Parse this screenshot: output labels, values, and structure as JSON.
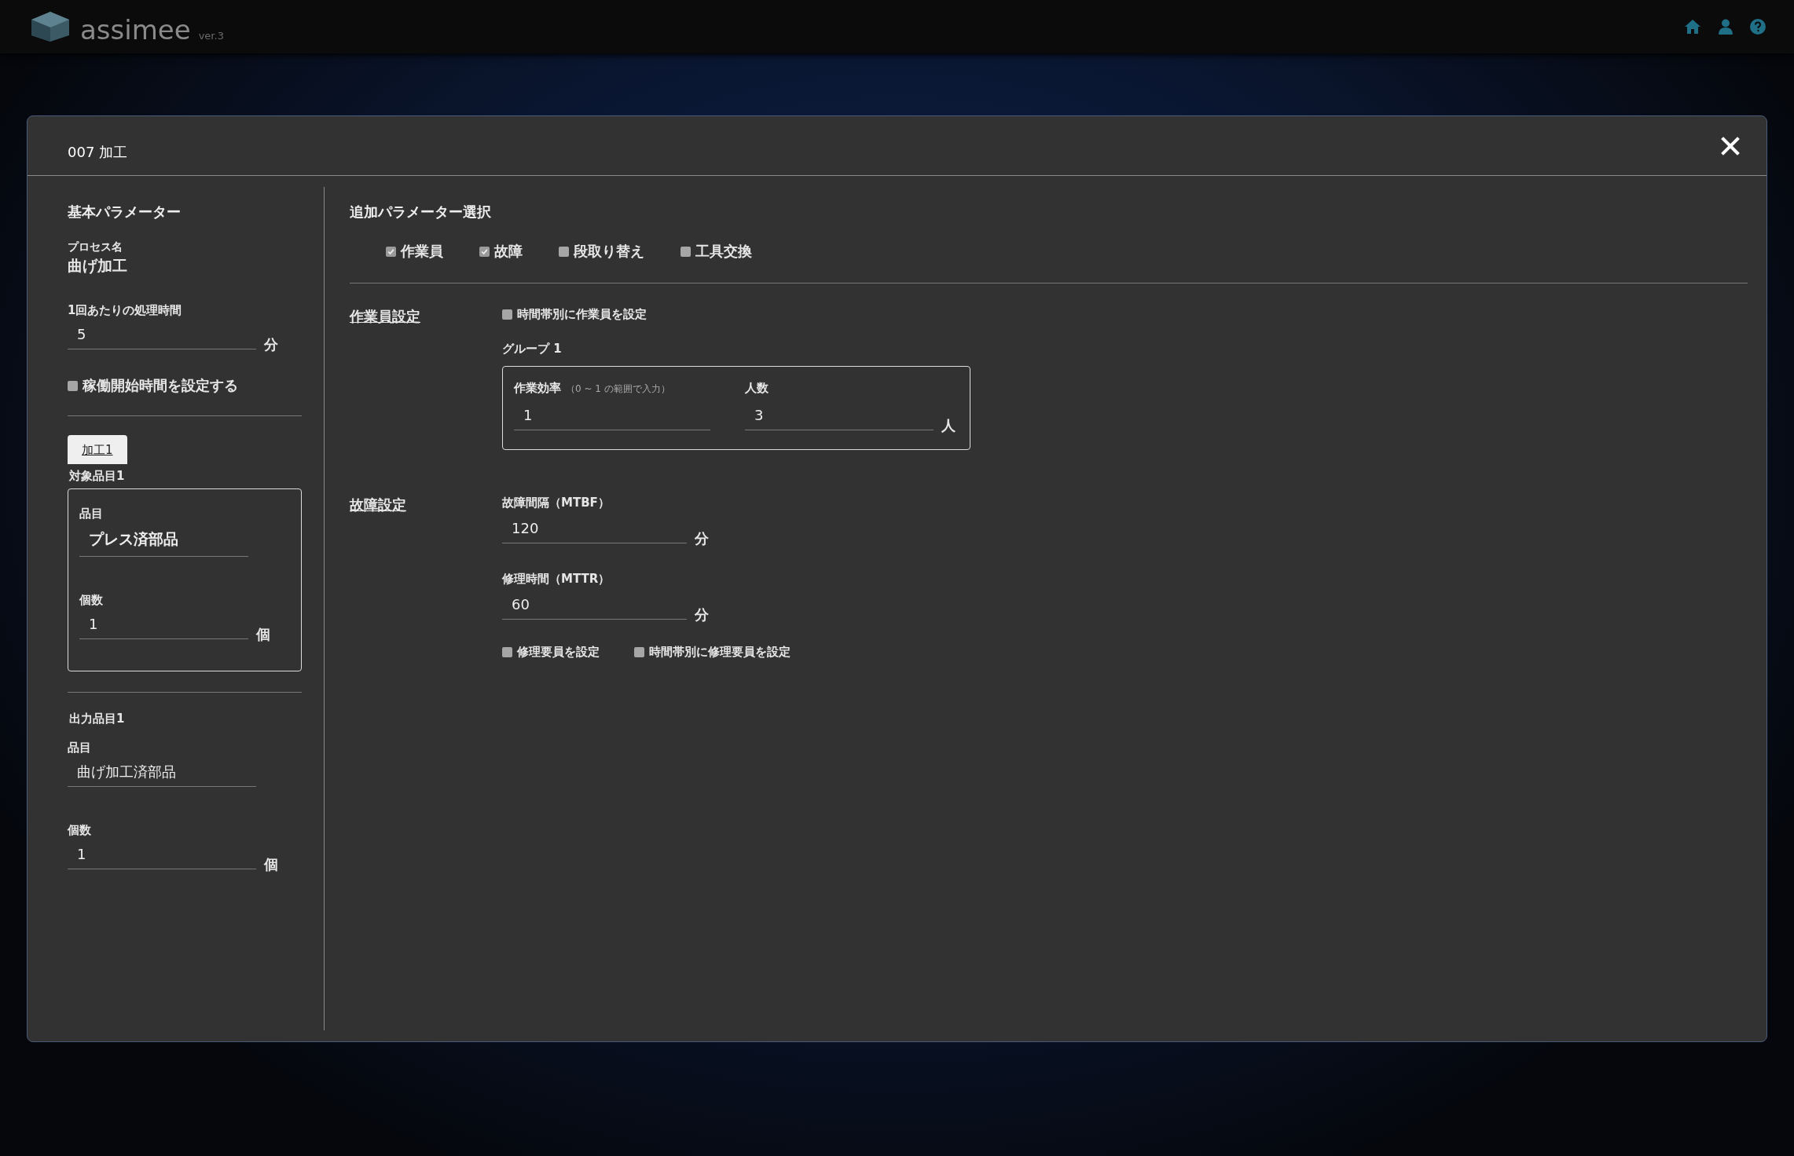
{
  "app": {
    "logo_text": "assimee",
    "version": "ver.3"
  },
  "dialog": {
    "title": "007 加工",
    "basic": {
      "heading": "基本パラメーター",
      "process_label": "プロセス名",
      "process_name": "曲げ加工",
      "time": {
        "label": "1回あたりの処理時間",
        "value": "5",
        "unit": "分"
      },
      "start_time": {
        "label": "稼働開始時間を設定する",
        "checked": false
      },
      "tabs": [
        {
          "label": "加工1",
          "selected": true
        }
      ],
      "inputs": [
        {
          "heading": "対象品目1",
          "item_label": "品目",
          "item_value": "プレス済部品",
          "count_label": "個数",
          "count_value": "1",
          "unit": "個"
        }
      ],
      "outputs": [
        {
          "heading": "出力品目1",
          "item_label": "品目",
          "item_value": "曲げ加工済部品",
          "count_label": "個数",
          "count_value": "1",
          "unit": "個"
        }
      ]
    },
    "extra": {
      "heading": "追加パラメーター選択",
      "options": [
        {
          "label": "作業員",
          "checked": true
        },
        {
          "label": "故障",
          "checked": true
        },
        {
          "label": "段取り替え",
          "checked": false
        },
        {
          "label": "工具交換",
          "checked": false
        }
      ]
    },
    "worker": {
      "heading": "作業員設定",
      "by_time": {
        "label": "時間帯別に作業員を設定",
        "checked": false
      },
      "groups": [
        {
          "title": "グループ 1",
          "efficiency_label": "作業効率",
          "efficiency_hint": "（0 ~ 1 の範囲で入力）",
          "efficiency_value": "1",
          "count_label": "人数",
          "count_value": "3",
          "unit": "人"
        }
      ]
    },
    "failure": {
      "heading": "故障設定",
      "fields": [
        {
          "label": "故障間隔（MTBF）",
          "value": "120",
          "unit": "分"
        },
        {
          "label": "修理時間（MTTR）",
          "value": "60",
          "unit": "分"
        }
      ],
      "options": [
        {
          "label": "修理要員を設定",
          "checked": false
        },
        {
          "label": "時間帯別に修理要員を設定",
          "checked": false
        }
      ]
    }
  }
}
